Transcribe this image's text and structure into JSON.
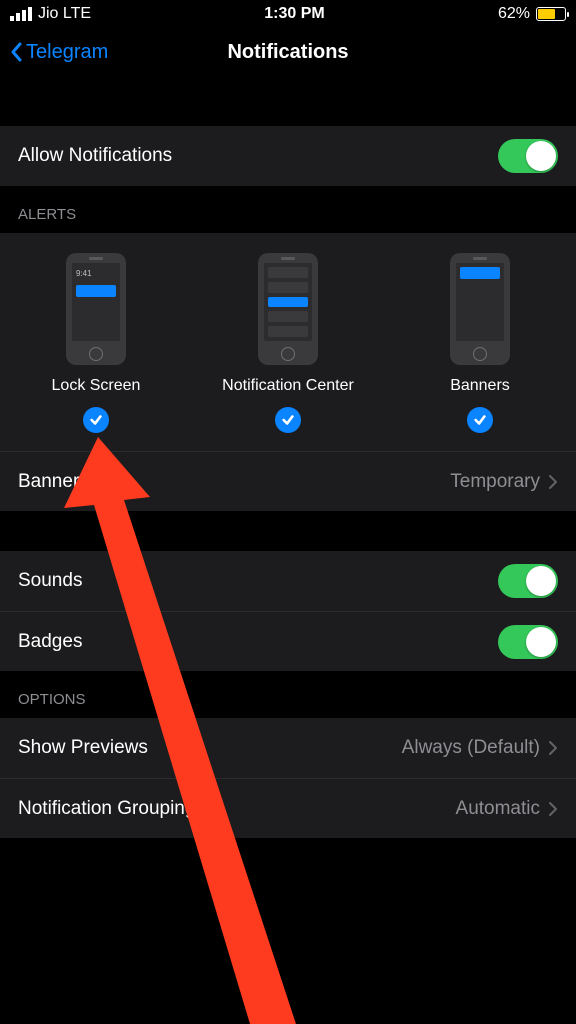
{
  "status": {
    "carrier": "Jio  LTE",
    "time": "1:30 PM",
    "battery_pct": "62%"
  },
  "nav": {
    "back_label": "Telegram",
    "title": "Notifications"
  },
  "rows": {
    "allow_notifications": "Allow Notifications",
    "banner_style": "Banner Style",
    "banner_style_value": "Temporary",
    "sounds": "Sounds",
    "badges": "Badges",
    "show_previews": "Show Previews",
    "show_previews_value": "Always (Default)",
    "notification_grouping": "Notification Grouping",
    "notification_grouping_value": "Automatic"
  },
  "headers": {
    "alerts": "ALERTS",
    "options": "OPTIONS"
  },
  "alerts": {
    "lock_screen": "Lock Screen",
    "notification_center": "Notification Center",
    "banners": "Banners",
    "preview_time": "9:41"
  },
  "toggles": {
    "allow_notifications": true,
    "sounds": true,
    "badges": true
  },
  "alert_checks": {
    "lock_screen": true,
    "notification_center": true,
    "banners": true
  }
}
